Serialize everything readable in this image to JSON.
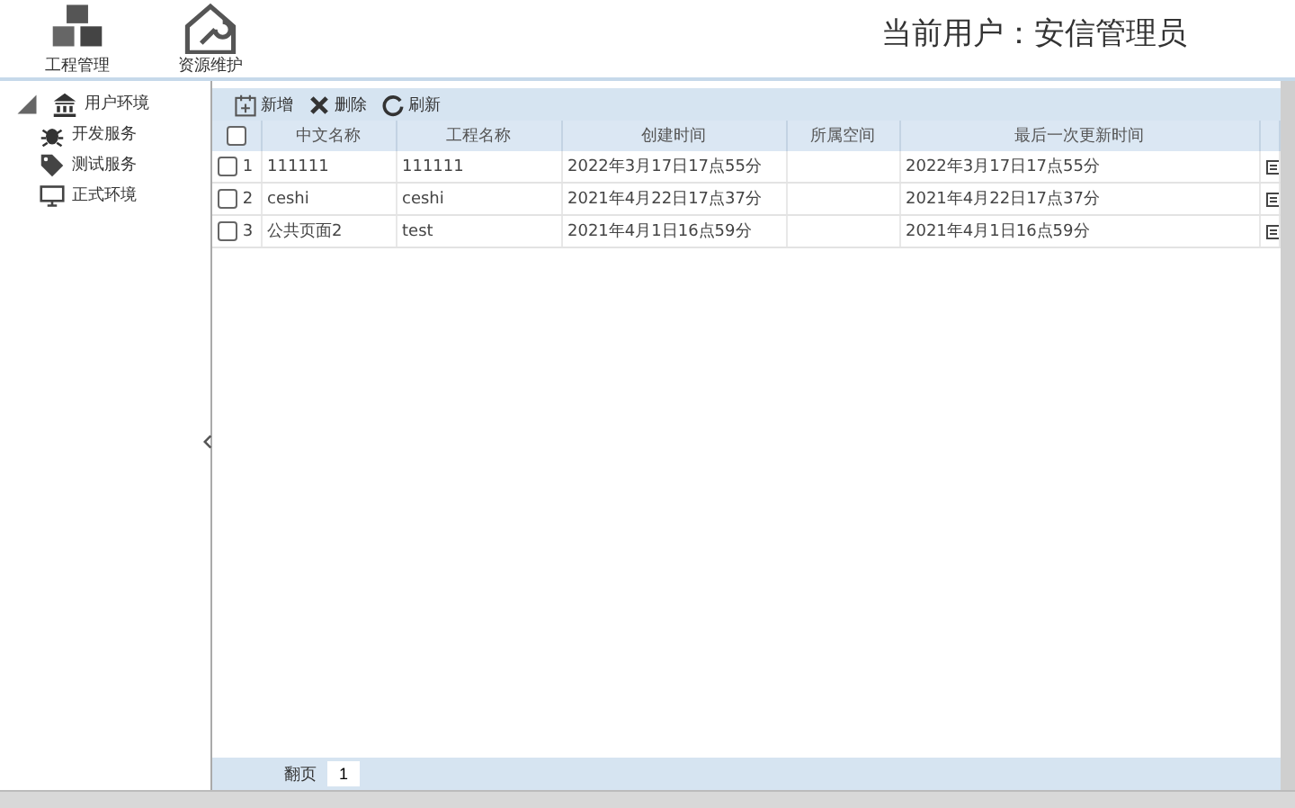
{
  "header": {
    "nav": [
      {
        "label": "工程管理"
      },
      {
        "label": "资源维护"
      }
    ],
    "current_user": "当前用户：安信管理员"
  },
  "sidebar": {
    "tree": [
      {
        "label": "用户环境",
        "expanded": true,
        "children": [
          {
            "label": "开发服务"
          },
          {
            "label": "测试服务"
          },
          {
            "label": "正式环境"
          }
        ]
      }
    ]
  },
  "toolbar": [
    {
      "label": "新增"
    },
    {
      "label": "删除"
    },
    {
      "label": "刷新"
    }
  ],
  "table": {
    "header_checked": false,
    "columns": [
      "中文名称",
      "工程名称",
      "创建时间",
      "所属空间",
      "最后一次更新时间"
    ],
    "rows": [
      {
        "checked": false,
        "number": "1",
        "cells": [
          "111111",
          "111111",
          "2022年3月17日17点55分",
          "",
          "2022年3月17日17点55分"
        ]
      },
      {
        "checked": false,
        "number": "2",
        "cells": [
          "ceshi",
          "ceshi",
          "2021年4月22日17点37分",
          "",
          "2021年4月22日17点37分"
        ]
      },
      {
        "checked": false,
        "number": "3",
        "cells": [
          "公共页面2",
          "test",
          "2021年4月1日16点59分",
          "",
          "2021年4月1日16点59分"
        ]
      }
    ]
  },
  "pager": {
    "label": "翻页",
    "page": "1"
  }
}
